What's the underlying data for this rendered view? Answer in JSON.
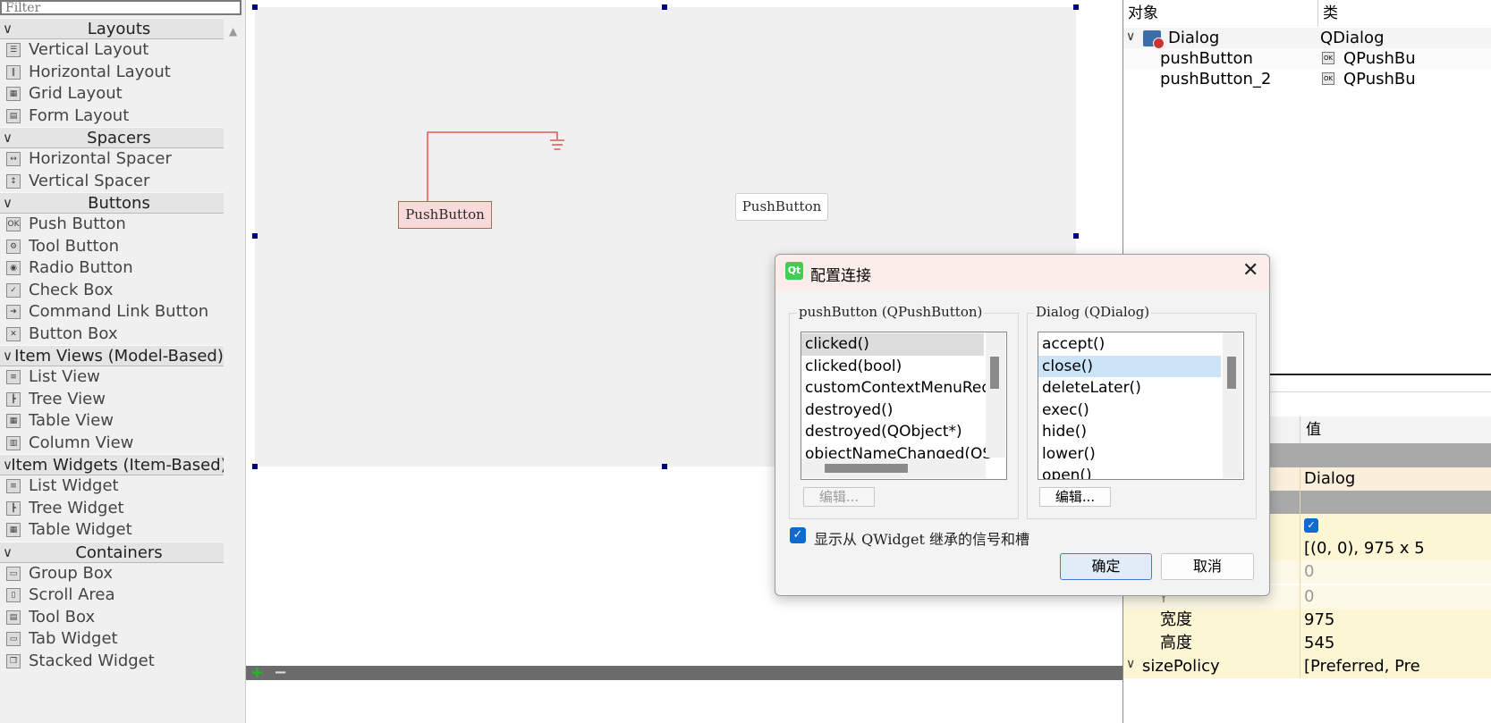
{
  "widget_box": {
    "filter_placeholder": "Filter",
    "categories": [
      {
        "label": "Layouts",
        "items": [
          {
            "label": "Vertical Layout",
            "icon": "vertical-layout-icon"
          },
          {
            "label": "Horizontal Layout",
            "icon": "horizontal-layout-icon"
          },
          {
            "label": "Grid Layout",
            "icon": "grid-layout-icon"
          },
          {
            "label": "Form Layout",
            "icon": "form-layout-icon"
          }
        ]
      },
      {
        "label": "Spacers",
        "items": [
          {
            "label": "Horizontal Spacer",
            "icon": "horizontal-spacer-icon"
          },
          {
            "label": "Vertical Spacer",
            "icon": "vertical-spacer-icon"
          }
        ]
      },
      {
        "label": "Buttons",
        "items": [
          {
            "label": "Push Button",
            "icon": "push-button-icon"
          },
          {
            "label": "Tool Button",
            "icon": "tool-button-icon"
          },
          {
            "label": "Radio Button",
            "icon": "radio-button-icon"
          },
          {
            "label": "Check Box",
            "icon": "check-box-icon"
          },
          {
            "label": "Command Link Button",
            "icon": "command-link-icon"
          },
          {
            "label": "Button Box",
            "icon": "button-box-icon"
          }
        ]
      },
      {
        "label": "Item Views (Model-Based)",
        "items": [
          {
            "label": "List View",
            "icon": "list-view-icon"
          },
          {
            "label": "Tree View",
            "icon": "tree-view-icon"
          },
          {
            "label": "Table View",
            "icon": "table-view-icon"
          },
          {
            "label": "Column View",
            "icon": "column-view-icon"
          }
        ]
      },
      {
        "label": "Item Widgets (Item-Based)",
        "items": [
          {
            "label": "List Widget",
            "icon": "list-widget-icon"
          },
          {
            "label": "Tree Widget",
            "icon": "tree-widget-icon"
          },
          {
            "label": "Table Widget",
            "icon": "table-widget-icon"
          }
        ]
      },
      {
        "label": "Containers",
        "items": [
          {
            "label": "Group Box",
            "icon": "group-box-icon"
          },
          {
            "label": "Scroll Area",
            "icon": "scroll-area-icon"
          },
          {
            "label": "Tool Box",
            "icon": "tool-box-icon"
          },
          {
            "label": "Tab Widget",
            "icon": "tab-widget-icon"
          },
          {
            "label": "Stacked Widget",
            "icon": "stacked-widget-icon"
          }
        ]
      }
    ]
  },
  "canvas": {
    "push_button_1": "PushButton",
    "push_button_2": "PushButton"
  },
  "object_inspector": {
    "col_object": "对象",
    "col_class": "类",
    "rows": [
      {
        "name": "Dialog",
        "class": "QDialog"
      },
      {
        "name": "pushButton",
        "class": "QPushBu"
      },
      {
        "name": "pushButton_2",
        "class": "QPushBu"
      }
    ],
    "ok_icon_text": "OK"
  },
  "property_editor": {
    "col_value": "值",
    "object_name_value": "Dialog",
    "geometry_value": "[(0, 0), 975 x 5",
    "x_value": "0",
    "y_label": "Y",
    "y_value": "0",
    "width_label": "宽度",
    "width_value": "975",
    "height_label": "高度",
    "height_value": "545",
    "size_policy_label": "sizePolicy",
    "size_policy_value": "[Preferred, Pre"
  },
  "connection_dialog": {
    "title": "配置连接",
    "sender_group_title": "pushButton (QPushButton)",
    "receiver_group_title": "Dialog (QDialog)",
    "signals": [
      "clicked()",
      "clicked(bool)",
      "customContextMenuReq",
      "destroyed()",
      "destroyed(QObject*)",
      "objectNameChanged(QS"
    ],
    "slots": [
      "accept()",
      "close()",
      "deleteLater()",
      "exec()",
      "hide()",
      "lower()",
      "open()"
    ],
    "edit_label_left": "编辑...",
    "edit_label_right": "编辑...",
    "show_inherited_label": "显示从 QWidget 继承的信号和槽",
    "show_inherited_checked": true,
    "ok_label": "确定",
    "cancel_label": "取消"
  },
  "colors": {
    "selection_handle": "#00007a",
    "connection_line": "#e03a3a",
    "selected_slot": "#cce4f7",
    "accent_blue": "#0f6ccf"
  }
}
